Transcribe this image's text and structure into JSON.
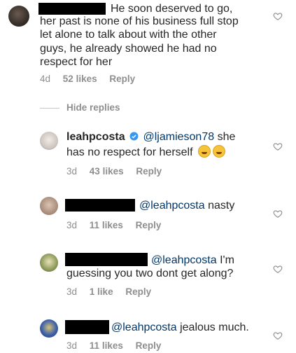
{
  "comment_main": {
    "line1": "He soon deserved to go,",
    "line2": "her past is none of his business full stop",
    "line3": "let alone to talk about with the other",
    "line4": "guys, he already showed he had no",
    "line5": "respect for her",
    "time": "4d",
    "likes": "52 likes",
    "reply": "Reply"
  },
  "hide_replies": "Hide replies",
  "replies": [
    {
      "username": "leahpcosta",
      "verified": true,
      "mention": "@ljamieson78",
      "line1": "she",
      "line2": "has no respect for herself",
      "time": "3d",
      "likes": "43 likes",
      "reply": "Reply"
    },
    {
      "mention": "@leahpcosta",
      "text": "nasty",
      "time": "3d",
      "likes": "11 likes",
      "reply": "Reply"
    },
    {
      "mention": "@leahpcosta",
      "text": "I'm",
      "line2": "guessing you two dont get along?",
      "time": "3d",
      "likes": "1 like",
      "reply": "Reply"
    },
    {
      "mention": "@leahpcosta",
      "text": "jealous much.",
      "time": "3d",
      "likes": "11 likes",
      "reply": "Reply"
    }
  ],
  "icons": {
    "heart": "heart-icon",
    "verified": "verified-badge-icon",
    "emoji": "laughing-emoji-icon"
  },
  "colors": {
    "text": "#262626",
    "meta": "#8e8e8e",
    "mention": "#00376b",
    "verified": "#3897f0"
  }
}
